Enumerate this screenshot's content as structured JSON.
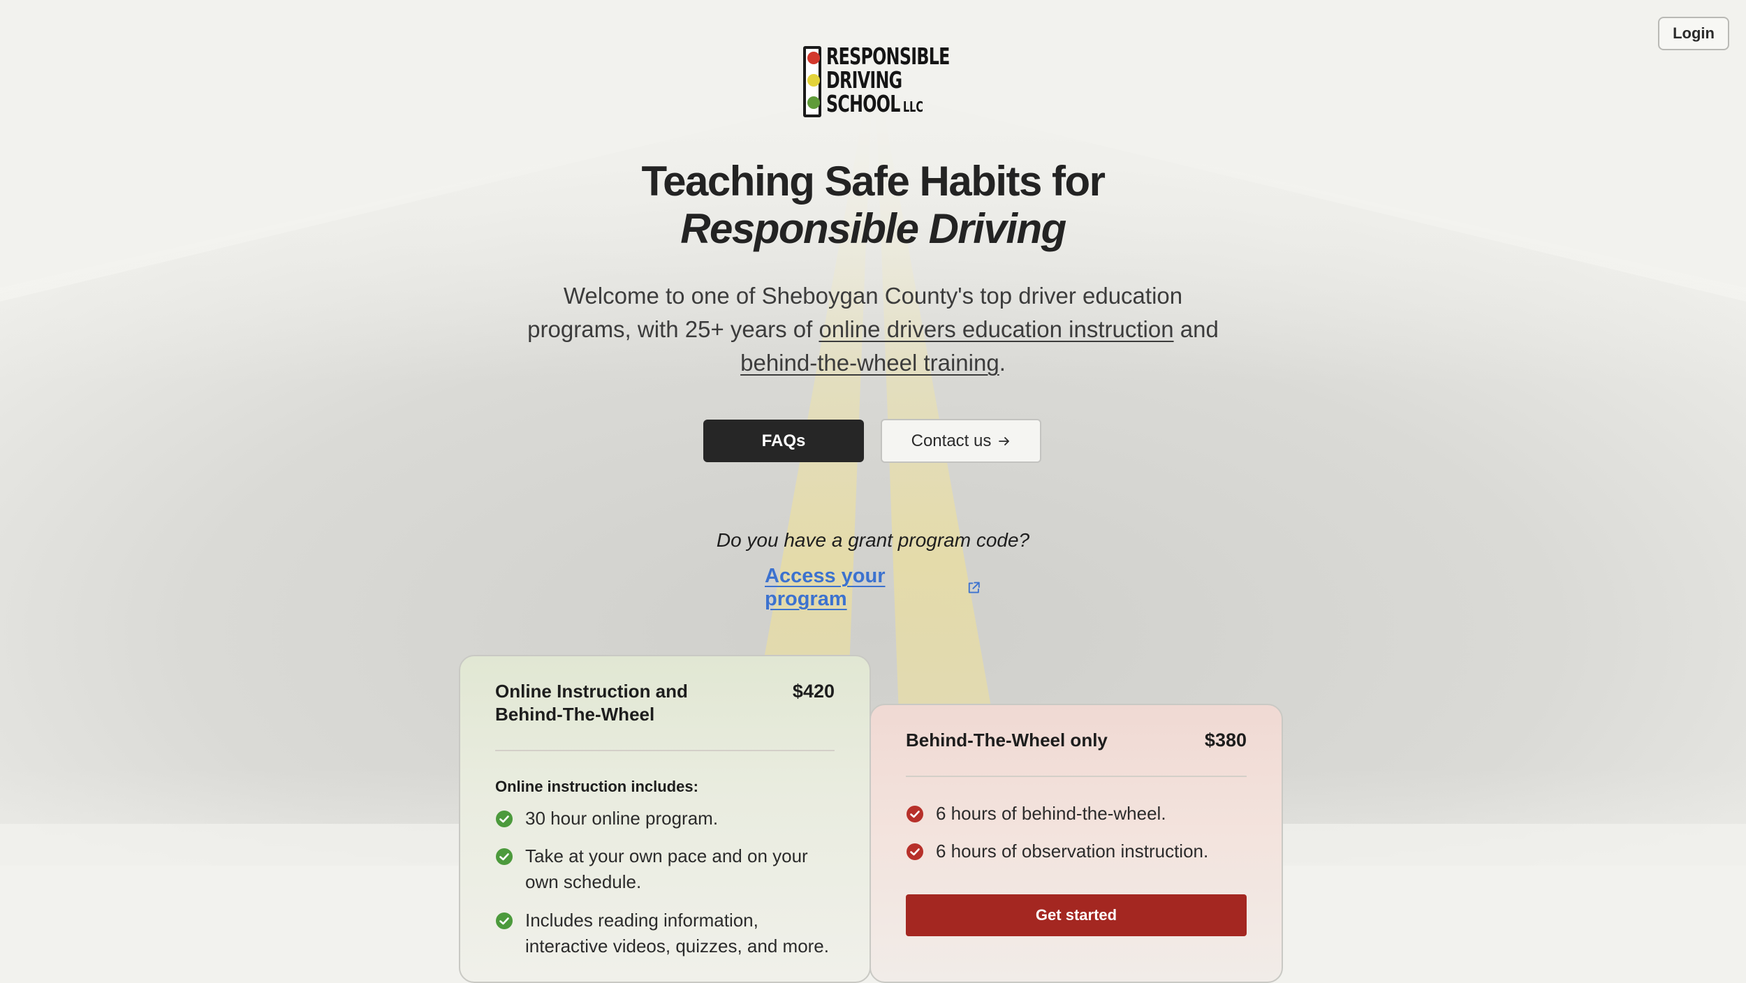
{
  "header": {
    "login_label": "Login"
  },
  "logo": {
    "line1": "RESPONSIBLE",
    "line2": "DRIVING",
    "line3": "SCHOOL",
    "suffix": "LLC",
    "light_colors": [
      "#d2382c",
      "#e3d33b",
      "#5f9b39"
    ]
  },
  "hero": {
    "title_line1": "Teaching Safe Habits for",
    "title_line2": "Responsible Driving",
    "intro_text1": "Welcome to one of Sheboygan County's top driver education programs, with 25+ years of ",
    "intro_link1": "online drivers education instruction",
    "intro_text2": " and ",
    "intro_link2": "behind-the-wheel training",
    "intro_text3": "."
  },
  "actions": {
    "faqs_label": "FAQs",
    "contact_label": "Contact us",
    "contact_icon": "arrow-right-icon"
  },
  "grant": {
    "question": "Do you have a grant program code?",
    "link_label": "Access your program",
    "link_icon": "external-link-icon",
    "link_color": "#3c72cf"
  },
  "cards": {
    "online": {
      "name": "Online Instruction and Behind-The-Wheel",
      "price": "$420",
      "includes_label": "Online instruction includes:",
      "features": [
        "30 hour online program.",
        "Take at your own pace and on your own schedule.",
        "Includes reading information, interactive videos, quizzes, and more."
      ],
      "check_color": "#4c9a3c"
    },
    "behind_wheel": {
      "name": "Behind-The-Wheel only",
      "price": "$380",
      "features": [
        "6 hours of behind-the-wheel.",
        "6 hours of observation instruction."
      ],
      "check_color": "#b7302a",
      "cta_label": "Get started",
      "cta_color": "#a42721"
    }
  }
}
